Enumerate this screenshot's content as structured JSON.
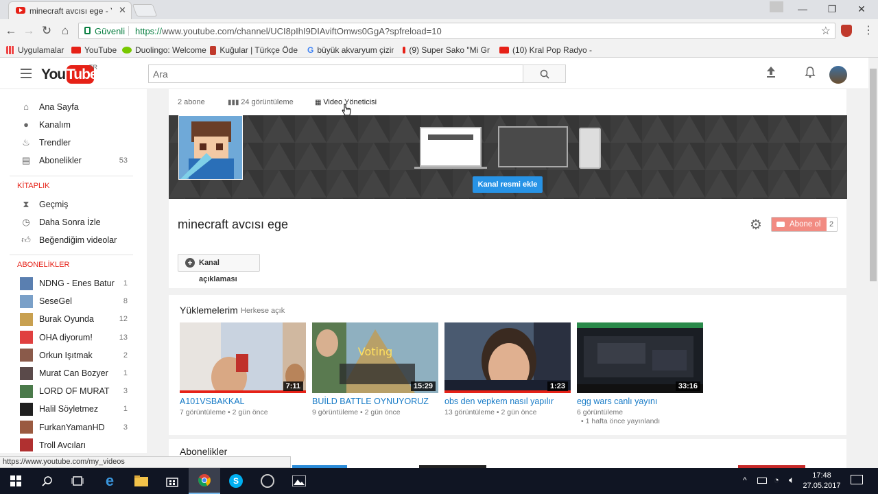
{
  "browser": {
    "tab_title": "minecraft avcısı ege - You",
    "security_label": "Güvenli",
    "url_scheme": "https://",
    "url_rest": "www.youtube.com/channel/UCI8pIhI9DIAviftOmws0GgA?spfreload=10",
    "bookmarks": [
      {
        "label": "Uygulamalar",
        "icon": "apps-grid-icon",
        "color": "#4285f4"
      },
      {
        "label": "YouTube",
        "icon": "youtube-icon",
        "color": "#e62117"
      },
      {
        "label": "Duolingo: Welcome",
        "icon": "duolingo-icon",
        "color": "#78c800"
      },
      {
        "label": "Kuğular | Türkçe Öde",
        "icon": "page-icon",
        "color": "#c0392b"
      },
      {
        "label": "büyük akvaryum çizim",
        "icon": "google-icon",
        "color": "#4285f4"
      },
      {
        "label": "(9) Super Sako \"Mi Gr",
        "icon": "youtube-icon",
        "color": "#e62117"
      },
      {
        "label": "(10) Kral Pop Radyo -",
        "icon": "youtube-icon",
        "color": "#e62117"
      }
    ]
  },
  "masthead": {
    "logo_you": "You",
    "logo_tube": "Tube",
    "logo_region": "TR",
    "search_placeholder": "Ara"
  },
  "sidebar": {
    "main": [
      {
        "label": "Ana Sayfa",
        "icon": "home-icon"
      },
      {
        "label": "Kanalım",
        "icon": "account-icon"
      },
      {
        "label": "Trendler",
        "icon": "flame-icon"
      },
      {
        "label": "Abonelikler",
        "icon": "subscriptions-icon",
        "count": "53"
      }
    ],
    "library_heading": "KİTAPLIK",
    "library": [
      {
        "label": "Geçmiş",
        "icon": "hourglass-icon"
      },
      {
        "label": "Daha Sonra İzle",
        "icon": "clock-icon"
      },
      {
        "label": "Beğendiğim videolar",
        "icon": "thumbs-up-icon"
      }
    ],
    "subs_heading": "ABONELİKLER",
    "subscriptions": [
      {
        "label": "NDNG - Enes Batur",
        "count": "1",
        "color": "#5a7fb0"
      },
      {
        "label": "SeseGel",
        "count": "8",
        "color": "#7aa0c8"
      },
      {
        "label": "Burak Oyunda",
        "count": "12",
        "color": "#c8a050"
      },
      {
        "label": "OHA diyorum!",
        "count": "13",
        "color": "#e04040"
      },
      {
        "label": "Orkun Işıtmak",
        "count": "2",
        "color": "#8a5a4a"
      },
      {
        "label": "Murat Can Bozyer",
        "count": "1",
        "color": "#5a4a4a"
      },
      {
        "label": "LORD OF MURAT",
        "count": "3",
        "color": "#4a7a4a"
      },
      {
        "label": "Halil Söyletmez",
        "count": "1",
        "color": "#202020"
      },
      {
        "label": "FurkanYamanHD",
        "count": "3",
        "color": "#9a5a40"
      },
      {
        "label": "Troll Avcıları",
        "count": "",
        "color": "#b03030"
      }
    ]
  },
  "channel": {
    "subscribers": "2 abone",
    "views": "24 görüntüleme",
    "video_manager": "Video Yöneticisi",
    "add_art": "Kanal resmi ekle",
    "title": "minecraft avcısı ege",
    "subscribe_label": "Abone ol",
    "subscribe_count": "2",
    "description_button": "Kanal açıklaması"
  },
  "uploads": {
    "title": "Yüklemelerim",
    "visibility": "Herkese açık",
    "videos": [
      {
        "title": "A101VSBAKKAL",
        "duration": "7:11",
        "meta": "7 görüntüleme • 2 gün önce",
        "meta2": ""
      },
      {
        "title": "BUİLD BATTLE OYNUYORUZ",
        "duration": "15:29",
        "meta": "9 görüntüleme • 2 gün önce",
        "meta2": ""
      },
      {
        "title": "obs den vepkem nasıl yapılır",
        "duration": "1:23",
        "meta": "13 görüntüleme • 2 gün önce",
        "meta2": ""
      },
      {
        "title": "egg wars canlı yayını",
        "duration": "33:16",
        "meta": "6 görüntüleme",
        "meta2": "• 1 hafta önce yayınlandı"
      }
    ]
  },
  "subscriptions_section": {
    "title": "Abonelikler"
  },
  "status_bar": "https://www.youtube.com/my_videos",
  "taskbar": {
    "time": "17:48",
    "date": "27.05.2017"
  }
}
